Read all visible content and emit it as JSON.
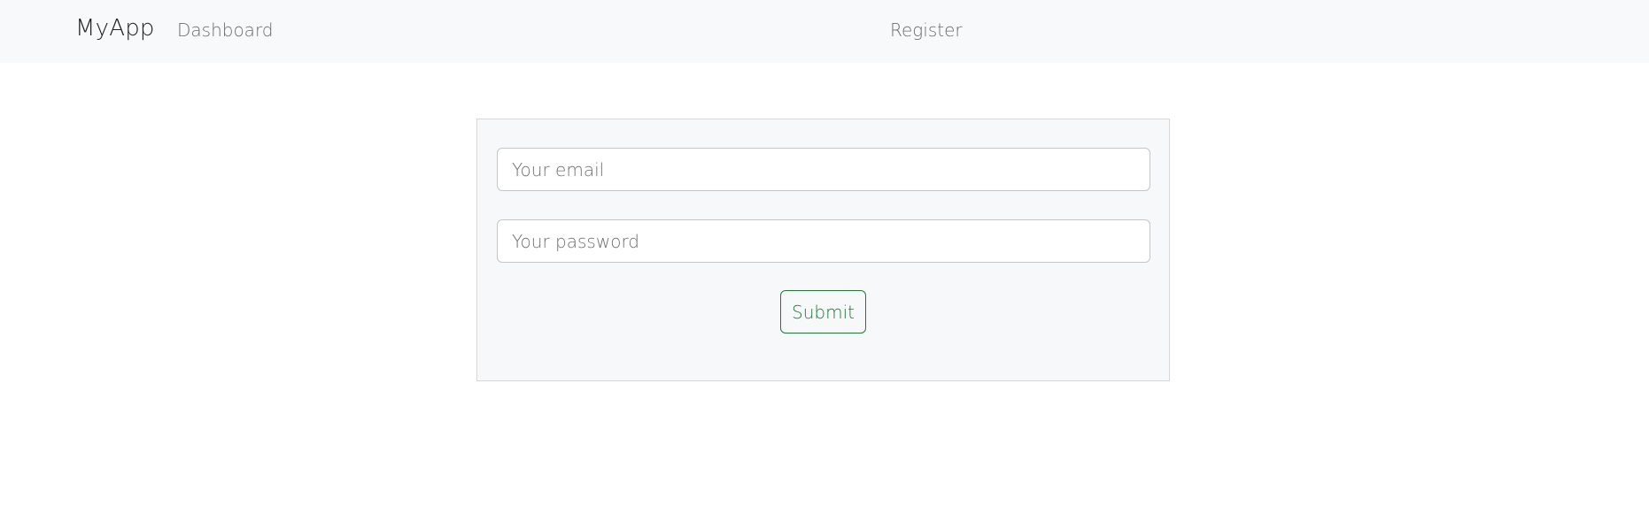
{
  "navbar": {
    "brand": "MyApp",
    "links": {
      "dashboard": "Dashboard",
      "register": "Register"
    }
  },
  "form": {
    "email": {
      "placeholder": "Your email",
      "value": ""
    },
    "password": {
      "placeholder": "Your password",
      "value": ""
    },
    "submit_label": "Submit"
  },
  "colors": {
    "navbar_background": "#f8f9fa",
    "card_background": "#f7f8f9",
    "submit_accent": "#1f7a34"
  }
}
